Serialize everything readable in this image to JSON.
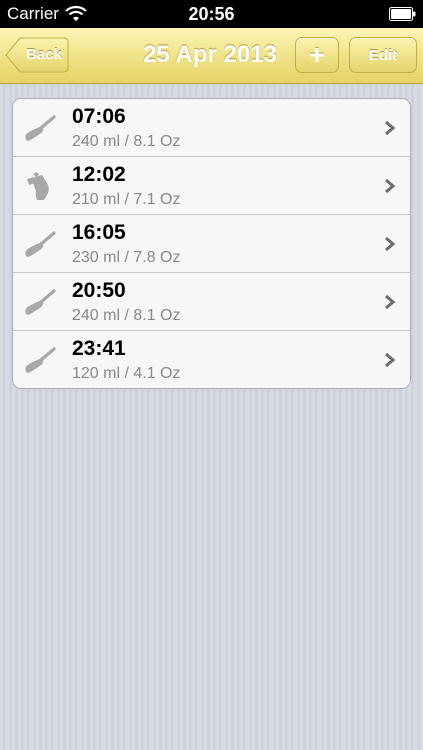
{
  "status_bar": {
    "carrier": "Carrier",
    "time": "20:56",
    "wifi_icon": "wifi-icon",
    "battery_icon": "battery-full-icon"
  },
  "nav": {
    "back_label": "Back",
    "title": "25 Apr 2013",
    "add_label": "+",
    "edit_label": "Edit",
    "accent_color": "#f2e58d"
  },
  "feedings": [
    {
      "time": "07:06",
      "amount": "240 ml / 8.1 Oz",
      "icon": "spoon-icon"
    },
    {
      "time": "12:02",
      "amount": "210 ml / 7.1 Oz",
      "icon": "bottle-icon"
    },
    {
      "time": "16:05",
      "amount": "230 ml / 7.8 Oz",
      "icon": "spoon-icon"
    },
    {
      "time": "20:50",
      "amount": "240 ml / 8.1 Oz",
      "icon": "spoon-icon"
    },
    {
      "time": "23:41",
      "amount": "120 ml / 4.1 Oz",
      "icon": "spoon-icon"
    }
  ]
}
